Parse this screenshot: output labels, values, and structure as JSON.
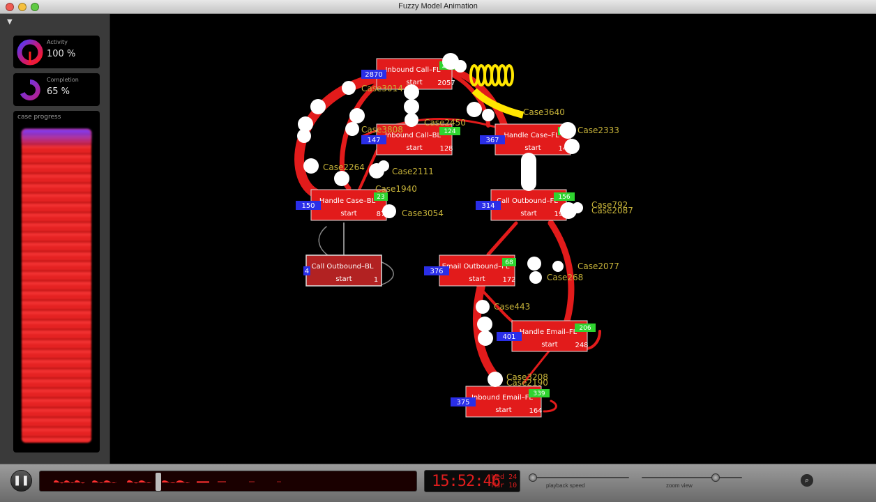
{
  "window": {
    "title": "Fuzzy Model Animation"
  },
  "sidebar": {
    "activity": {
      "label": "Activity",
      "value": "100 %"
    },
    "completion": {
      "label": "Completion",
      "value": "65 %"
    },
    "progress_label": "case progress"
  },
  "nodes": [
    {
      "id": "inbound_call_fl",
      "label": "Inbound Call–FL",
      "start": "start",
      "in": "2870",
      "top_count": "2472",
      "bottom_count": "2057"
    },
    {
      "id": "inbound_call_bl",
      "label": "Inbound Call–BL",
      "start": "start",
      "in": "147",
      "top_count": "124",
      "bottom_count": "128"
    },
    {
      "id": "handle_case_fl",
      "label": "Handle Case–FL",
      "start": "start",
      "in": "367",
      "top_count": "79",
      "bottom_count": "140"
    },
    {
      "id": "handle_case_bl",
      "label": "Handle Case–BL",
      "start": "start",
      "in": "150",
      "top_count": "23",
      "bottom_count": "87"
    },
    {
      "id": "call_outbound_fl",
      "label": "Call Outbound–FL",
      "start": "start",
      "in": "314",
      "top_count": "156",
      "bottom_count": "197"
    },
    {
      "id": "call_outbound_bl",
      "label": "Call Outbound–BL",
      "start": "start",
      "in": "4",
      "top_count": "",
      "bottom_count": "1"
    },
    {
      "id": "email_outbound_fl",
      "label": "Email Outbound–FL",
      "start": "start",
      "in": "376",
      "top_count": "68",
      "bottom_count": "172"
    },
    {
      "id": "handle_email_fl",
      "label": "Handle Email–FL",
      "start": "start",
      "in": "401",
      "top_count": "206",
      "bottom_count": "248"
    },
    {
      "id": "inbound_email_fl",
      "label": "Inbound Email–FL",
      "start": "start",
      "in": "375",
      "top_count": "339",
      "bottom_count": "164"
    }
  ],
  "case_labels": [
    "Case3014",
    "Case2450",
    "Case3640",
    "Case2264",
    "Case2111",
    "Case1940",
    "Case3054",
    "Case2077",
    "Case268",
    "Case443",
    "Case3208",
    "Case2190",
    "Case792",
    "Case2087",
    "Case3808",
    "Case2333"
  ],
  "controls": {
    "pause_icon": "pause-icon",
    "clock": "15:52:46",
    "date_day": "Wed 24",
    "date_month": "Mar 10",
    "playback_speed_label": "playback speed",
    "zoom_view_label": "zoom view",
    "playback_speed": 0.0,
    "zoom_level": 0.72,
    "timeline_position": 0.31
  },
  "colors": {
    "node": "#e21b1b",
    "badge_in": "#2a2ee8",
    "badge_top": "#2fd42f",
    "label_case": "#c8b43a",
    "token": "#ffffff"
  }
}
